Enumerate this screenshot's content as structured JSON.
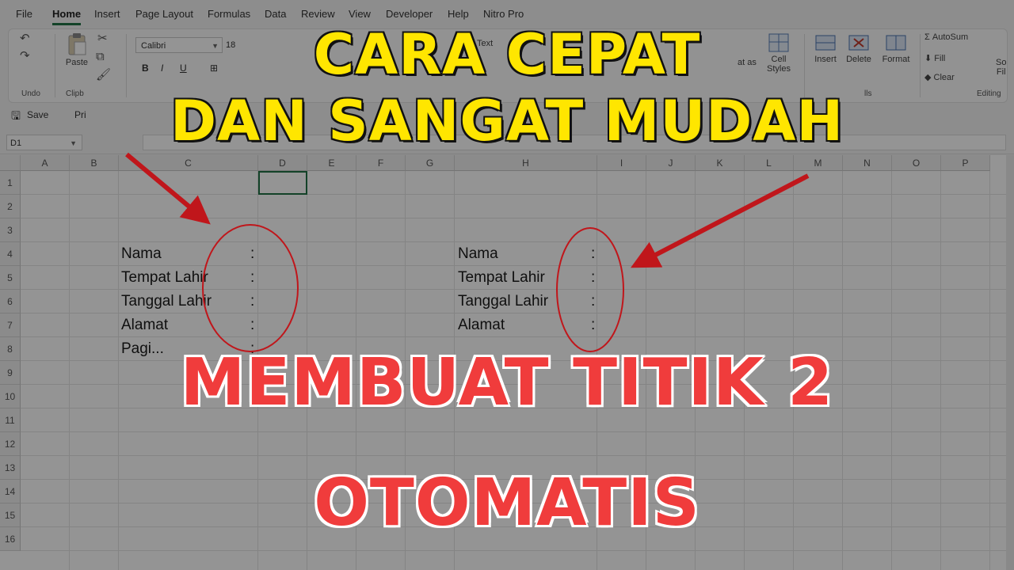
{
  "menu": {
    "items": [
      "File",
      "Home",
      "Insert",
      "Page Layout",
      "Formulas",
      "Data",
      "Review",
      "View",
      "Developer",
      "Help",
      "Nitro Pro"
    ]
  },
  "ribbon": {
    "groups": {
      "undo": "Undo",
      "clipboard": "Clipb",
      "cells": "lls",
      "editing": "Editing"
    },
    "paste": "Paste",
    "font_name": "Calibri",
    "font_size": "18",
    "bold": "B",
    "italic": "I",
    "underline": "U",
    "wrap_text": "p Text",
    "format_as": "at as",
    "cell_styles_1": "Cell",
    "cell_styles_2": "Styles",
    "insert": "Insert",
    "delete": "Delete",
    "format": "Format",
    "autosum": "AutoSum",
    "fill": "Fill",
    "clear": "Clear",
    "sort_1": "So",
    "sort_2": "Fil"
  },
  "quick_access": {
    "save": "Save",
    "print": "Pri"
  },
  "formula_bar": {
    "name_box": "D1"
  },
  "sheet": {
    "columns": [
      "A",
      "B",
      "C",
      "D",
      "E",
      "F",
      "G",
      "H",
      "I",
      "J",
      "K",
      "L",
      "M",
      "N",
      "O",
      "P"
    ],
    "rows": [
      "1",
      "2",
      "3",
      "4",
      "5",
      "6",
      "7",
      "8",
      "9",
      "10",
      "11",
      "12",
      "13",
      "14",
      "15",
      "16"
    ],
    "left_labels": [
      "Nama",
      "Tempat Lahir",
      "Tanggal Lahir",
      "Alamat",
      "Pagi..."
    ],
    "right_labels": [
      "Nama",
      "Tempat Lahir",
      "Tanggal Lahir",
      "Alamat"
    ],
    "colon": ":"
  },
  "overlay": {
    "line1": "CARA CEPAT",
    "line2": "DAN SANGAT MUDAH",
    "line3": "MEMBUAT TITIK 2",
    "line4": "OTOMATIS"
  },
  "colors": {
    "accent": "#217346",
    "headline_yellow": "#ffe600",
    "headline_red": "#f03c3c",
    "annotation_red": "#c0161b"
  }
}
